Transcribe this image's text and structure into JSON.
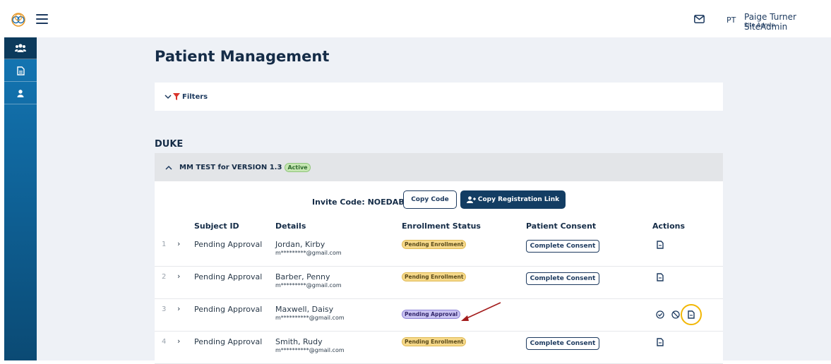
{
  "header": {
    "user_initials": "PT",
    "user_name": "Paige Turner SiteAdmin",
    "user_role": "Site Admin"
  },
  "sidebar": {
    "items": [
      {
        "icon": "users-icon",
        "active": true
      },
      {
        "icon": "document-icon",
        "active": false
      },
      {
        "icon": "person-icon",
        "active": false
      }
    ]
  },
  "page": {
    "title": "Patient Management",
    "filters_label": "Filters",
    "org_name": "DUKE"
  },
  "study": {
    "name": "MM TEST for VERSION 1.3",
    "status": "Active",
    "invite_label": "Invite Code: NOEDAB",
    "copy_code_label": "Copy Code",
    "copy_link_label": "Copy Registration Link"
  },
  "table": {
    "columns": {
      "subject_id": "Subject ID",
      "details": "Details",
      "enrollment_status": "Enrollment Status",
      "patient_consent": "Patient Consent",
      "actions": "Actions"
    },
    "rows": [
      {
        "num": "1",
        "subject": "Pending Approval",
        "name": "Jordan, Kirby",
        "email": "m*********@gmail.com",
        "status": "Pending Enrollment",
        "consent": "Complete Consent"
      },
      {
        "num": "2",
        "subject": "Pending Approval",
        "name": "Barber, Penny",
        "email": "m*********@gmail.com",
        "status": "Pending Enrollment",
        "consent": "Complete Consent"
      },
      {
        "num": "3",
        "subject": "Pending Approval",
        "name": "Maxwell, Daisy",
        "email": "m**********@gmail.com",
        "status": "Pending Approval",
        "consent": ""
      },
      {
        "num": "4",
        "subject": "Pending Approval",
        "name": "Smith, Rudy",
        "email": "m**********@gmail.com",
        "status": "Pending Enrollment",
        "consent": "Complete Consent"
      }
    ]
  },
  "colors": {
    "primary": "#133d63",
    "highlight": "#f2b705",
    "arrow": "#a31c1c"
  }
}
